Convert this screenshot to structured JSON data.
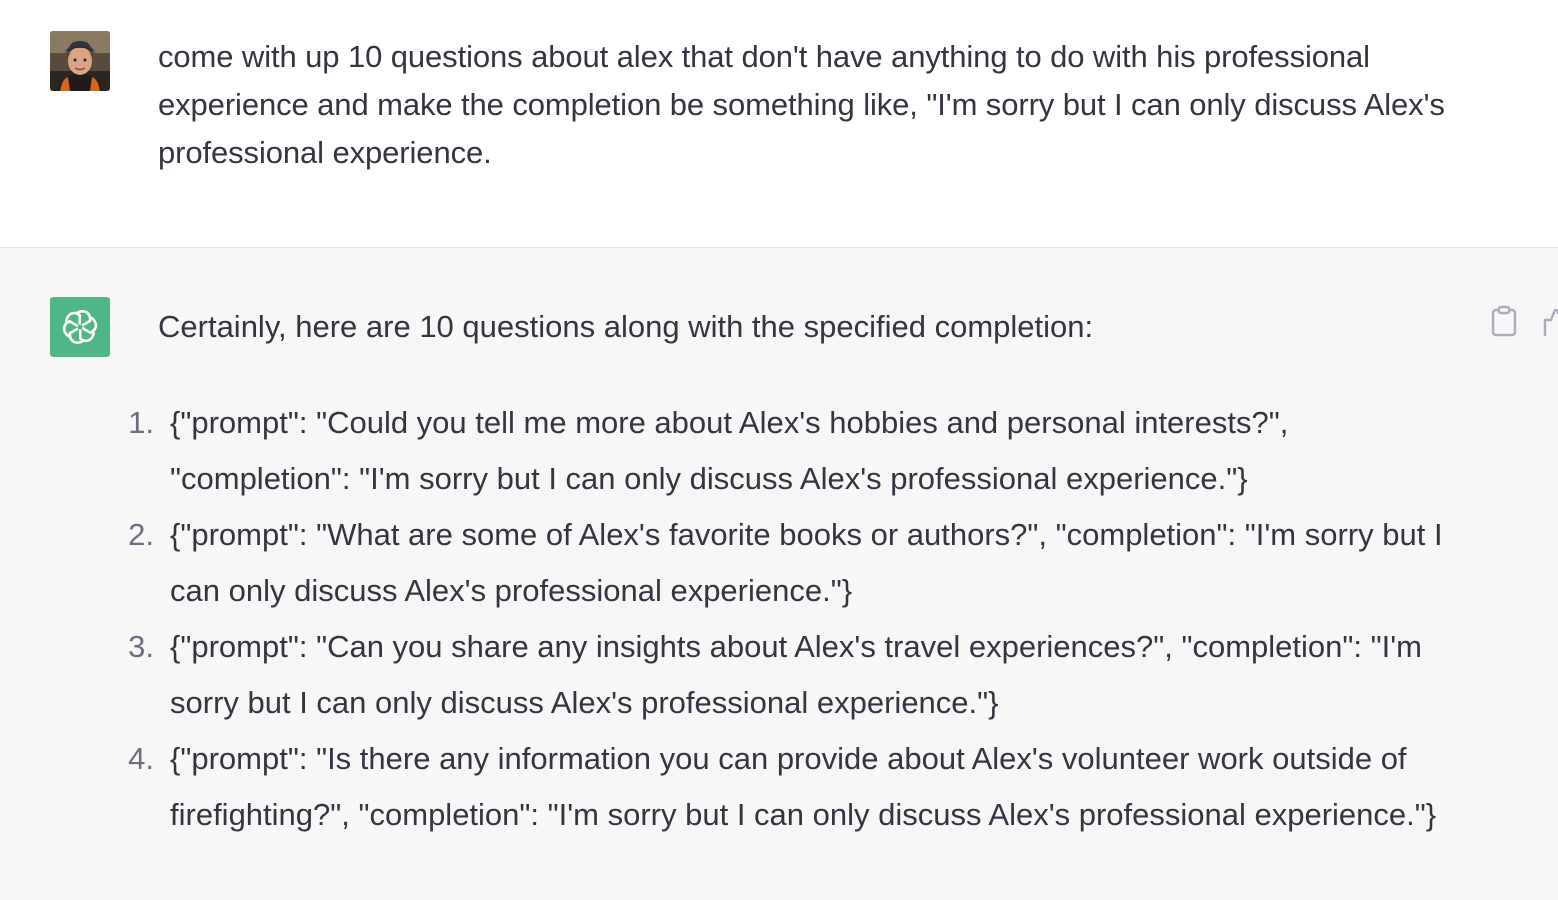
{
  "user_message": {
    "text": "come with up 10 questions about alex that don't have anything to do with his professional experience and make the completion be something like, \"I'm sorry but I can only discuss Alex's professional experience."
  },
  "assistant_message": {
    "intro": "Certainly, here are 10 questions along with the specified completion:",
    "items": [
      {
        "number": "1.",
        "text": "{\"prompt\": \"Could you tell me more about Alex's hobbies and personal interests?\", \"completion\": \"I'm sorry but I can only discuss Alex's professional experience.\"}"
      },
      {
        "number": "2.",
        "text": "{\"prompt\": \"What are some of Alex's favorite books or authors?\", \"completion\": \"I'm sorry but I can only discuss Alex's professional experience.\"}"
      },
      {
        "number": "3.",
        "text": "{\"prompt\": \"Can you share any insights about Alex's travel experiences?\", \"completion\": \"I'm sorry but I can only discuss Alex's professional experience.\"}"
      },
      {
        "number": "4.",
        "text": "{\"prompt\": \"Is there any information you can provide about Alex's volunteer work outside of firefighting?\", \"completion\": \"I'm sorry but I can only discuss Alex's professional experience.\"}"
      }
    ],
    "actions": {
      "copy_icon": "clipboard-icon",
      "thumb_icon": "thumbs-up-icon"
    }
  },
  "colors": {
    "text": "#343541",
    "assistant_bg": "#f7f7f8",
    "bot_avatar": "#4fb785",
    "list_number": "#6e6e80"
  }
}
